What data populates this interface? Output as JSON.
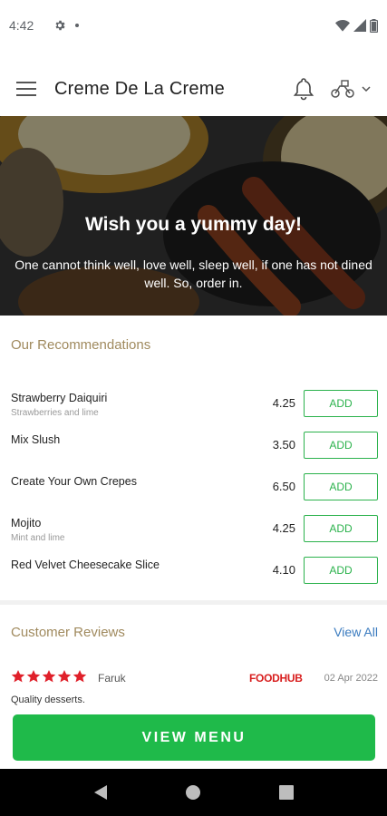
{
  "status_bar": {
    "time": "4:42"
  },
  "app_bar": {
    "title": "Creme De La Creme",
    "menu_icon": "hamburger-icon",
    "notification_icon": "bell-icon",
    "mode_icon": "scooter-icon",
    "dropdown_icon": "chevron-down-icon"
  },
  "hero": {
    "heading": "Wish you a yummy day!",
    "subtext": "One cannot think well, love well, sleep well, if one has not dined well. So, order in."
  },
  "recommendations": {
    "title": "Our Recommendations",
    "items": [
      {
        "name": "Strawberry Daiquiri",
        "description": "Strawberries and lime",
        "price": "4.25",
        "button": "ADD"
      },
      {
        "name": "Mix Slush",
        "description": "",
        "price": "3.50",
        "button": "ADD"
      },
      {
        "name": "Create Your Own Crepes",
        "description": "",
        "price": "6.50",
        "button": "ADD"
      },
      {
        "name": "Mojito",
        "description": "Mint and lime",
        "price": "4.25",
        "button": "ADD"
      },
      {
        "name": "Red Velvet Cheesecake Slice",
        "description": "",
        "price": "4.10",
        "button": "ADD"
      }
    ]
  },
  "reviews": {
    "title": "Customer Reviews",
    "view_all": "View All",
    "items": [
      {
        "rating": 5,
        "reviewer": "Faruk",
        "source": "FOODHUB",
        "date": "02 Apr 2022",
        "text": "Quality desserts."
      }
    ]
  },
  "cta": {
    "label": "VIEW MENU"
  },
  "colors": {
    "accent_green": "#1fba4a",
    "section_title": "#a08a5e",
    "star_red": "#e0202a",
    "link_blue": "#3a7bbf"
  }
}
